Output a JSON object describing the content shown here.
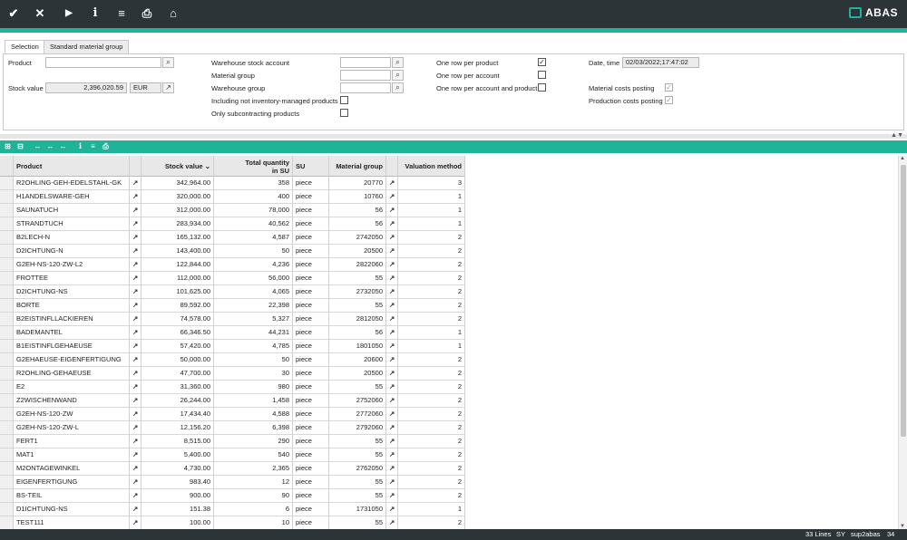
{
  "toolbar": {
    "icons": [
      "check-icon",
      "close-icon",
      "run-icon",
      "info-icon",
      "menu-icon",
      "print-icon",
      "home-icon"
    ],
    "glyphs": [
      "✔",
      "✕",
      "▶",
      "i",
      "≡",
      "⎙",
      "⌂"
    ],
    "logo": "ABAS"
  },
  "tabs": [
    "Selection",
    "Standard material group"
  ],
  "selection": {
    "product_label": "Product",
    "product_value": "",
    "stock_value_label": "Stock value",
    "stock_value": "2,396,020.59",
    "currency": "EUR",
    "warehouse_stock_account_label": "Warehouse stock account",
    "material_group_label": "Material group",
    "warehouse_group_label": "Warehouse group",
    "including_not_inventory_label": "Including not inventory-managed products",
    "only_subcontracting_label": "Only subcontracting products",
    "one_row_per_product_label": "One row per product",
    "one_row_per_account_label": "One row per account",
    "one_row_per_account_and_product_label": "One row per account and product",
    "date_time_label": "Date, time",
    "date_time_value": "02/03/2022;17:47:02",
    "material_costs_posting_label": "Material costs posting",
    "production_costs_posting_label": "Production costs posting",
    "checked_glyph": "✓"
  },
  "table": {
    "headers": {
      "product": "Product",
      "stock_value": "Stock value",
      "total_qty_line1": "Total quantity",
      "total_qty_line2": "in SU",
      "su": "SU",
      "material_group": "Material group",
      "valuation_method": "Valuation method",
      "sort_glyph": "⌄"
    },
    "link_glyph": "↗",
    "rows": [
      {
        "product": "R2OHLING-GEH-EDELSTAHL-GK",
        "stock_value": "342,964.00",
        "qty": "358",
        "su": "piece",
        "group": "20770",
        "method": "3"
      },
      {
        "product": "H1ANDELSWARE-GEH",
        "stock_value": "320,000.00",
        "qty": "400",
        "su": "piece",
        "group": "10760",
        "method": "1"
      },
      {
        "product": "SAUNATUCH",
        "stock_value": "312,000.00",
        "qty": "78,000",
        "su": "piece",
        "group": "56",
        "method": "1"
      },
      {
        "product": "STRANDTUCH",
        "stock_value": "283,934.00",
        "qty": "40,562",
        "su": "piece",
        "group": "56",
        "method": "1"
      },
      {
        "product": "B2LECH-N",
        "stock_value": "165,132.00",
        "qty": "4,587",
        "su": "piece",
        "group": "2742050",
        "method": "2"
      },
      {
        "product": "D2ICHTUNG-N",
        "stock_value": "143,400.00",
        "qty": "50",
        "su": "piece",
        "group": "20500",
        "method": "2"
      },
      {
        "product": "G2EH-NS-120-ZW-L2",
        "stock_value": "122,844.00",
        "qty": "4,236",
        "su": "piece",
        "group": "2822060",
        "method": "2"
      },
      {
        "product": "FROTTEE",
        "stock_value": "112,000.00",
        "qty": "56,000",
        "su": "piece",
        "group": "55",
        "method": "2"
      },
      {
        "product": "D2ICHTUNG-NS",
        "stock_value": "101,625.00",
        "qty": "4,065",
        "su": "piece",
        "group": "2732050",
        "method": "2"
      },
      {
        "product": "BORTE",
        "stock_value": "89,592.00",
        "qty": "22,398",
        "su": "piece",
        "group": "55",
        "method": "2"
      },
      {
        "product": "B2EISTINFLLACKIEREN",
        "stock_value": "74,578.00",
        "qty": "5,327",
        "su": "piece",
        "group": "2812050",
        "method": "2"
      },
      {
        "product": "BADEMANTEL",
        "stock_value": "66,346.50",
        "qty": "44,231",
        "su": "piece",
        "group": "56",
        "method": "1"
      },
      {
        "product": "B1EISTINFLGEHAEUSE",
        "stock_value": "57,420.00",
        "qty": "4,785",
        "su": "piece",
        "group": "1801050",
        "method": "1"
      },
      {
        "product": "G2EHAEUSE-EIGENFERTIGUNG",
        "stock_value": "50,000.00",
        "qty": "50",
        "su": "piece",
        "group": "20600",
        "method": "2"
      },
      {
        "product": "R2OHLING-GEHAEUSE",
        "stock_value": "47,700.00",
        "qty": "30",
        "su": "piece",
        "group": "20500",
        "method": "2"
      },
      {
        "product": "E2",
        "stock_value": "31,360.00",
        "qty": "980",
        "su": "piece",
        "group": "55",
        "method": "2"
      },
      {
        "product": "Z2WISCHENWAND",
        "stock_value": "26,244.00",
        "qty": "1,458",
        "su": "piece",
        "group": "2752060",
        "method": "2"
      },
      {
        "product": "G2EH-NS-120-ZW",
        "stock_value": "17,434.40",
        "qty": "4,588",
        "su": "piece",
        "group": "2772060",
        "method": "2"
      },
      {
        "product": "G2EH-NS-120-ZW-L",
        "stock_value": "12,156.20",
        "qty": "6,398",
        "su": "piece",
        "group": "2792060",
        "method": "2"
      },
      {
        "product": "FERT1",
        "stock_value": "8,515.00",
        "qty": "290",
        "su": "piece",
        "group": "55",
        "method": "2"
      },
      {
        "product": "MAT1",
        "stock_value": "5,400.00",
        "qty": "540",
        "su": "piece",
        "group": "55",
        "method": "2"
      },
      {
        "product": "M2ONTAGEWINKEL",
        "stock_value": "4,730.00",
        "qty": "2,365",
        "su": "piece",
        "group": "2762050",
        "method": "2"
      },
      {
        "product": "EIGENFERTIGUNG",
        "stock_value": "983.40",
        "qty": "12",
        "su": "piece",
        "group": "55",
        "method": "2"
      },
      {
        "product": "BS-TEIL",
        "stock_value": "900.00",
        "qty": "90",
        "su": "piece",
        "group": "55",
        "method": "2"
      },
      {
        "product": "D1ICHTUNG-NS",
        "stock_value": "151.38",
        "qty": "6",
        "su": "piece",
        "group": "1731050",
        "method": "1"
      },
      {
        "product": "TEST111",
        "stock_value": "100.00",
        "qty": "10",
        "su": "piece",
        "group": "55",
        "method": "2"
      }
    ]
  },
  "status": {
    "lines": "33 Lines",
    "mode": "SY",
    "user": "sup2abas",
    "count": "34"
  }
}
